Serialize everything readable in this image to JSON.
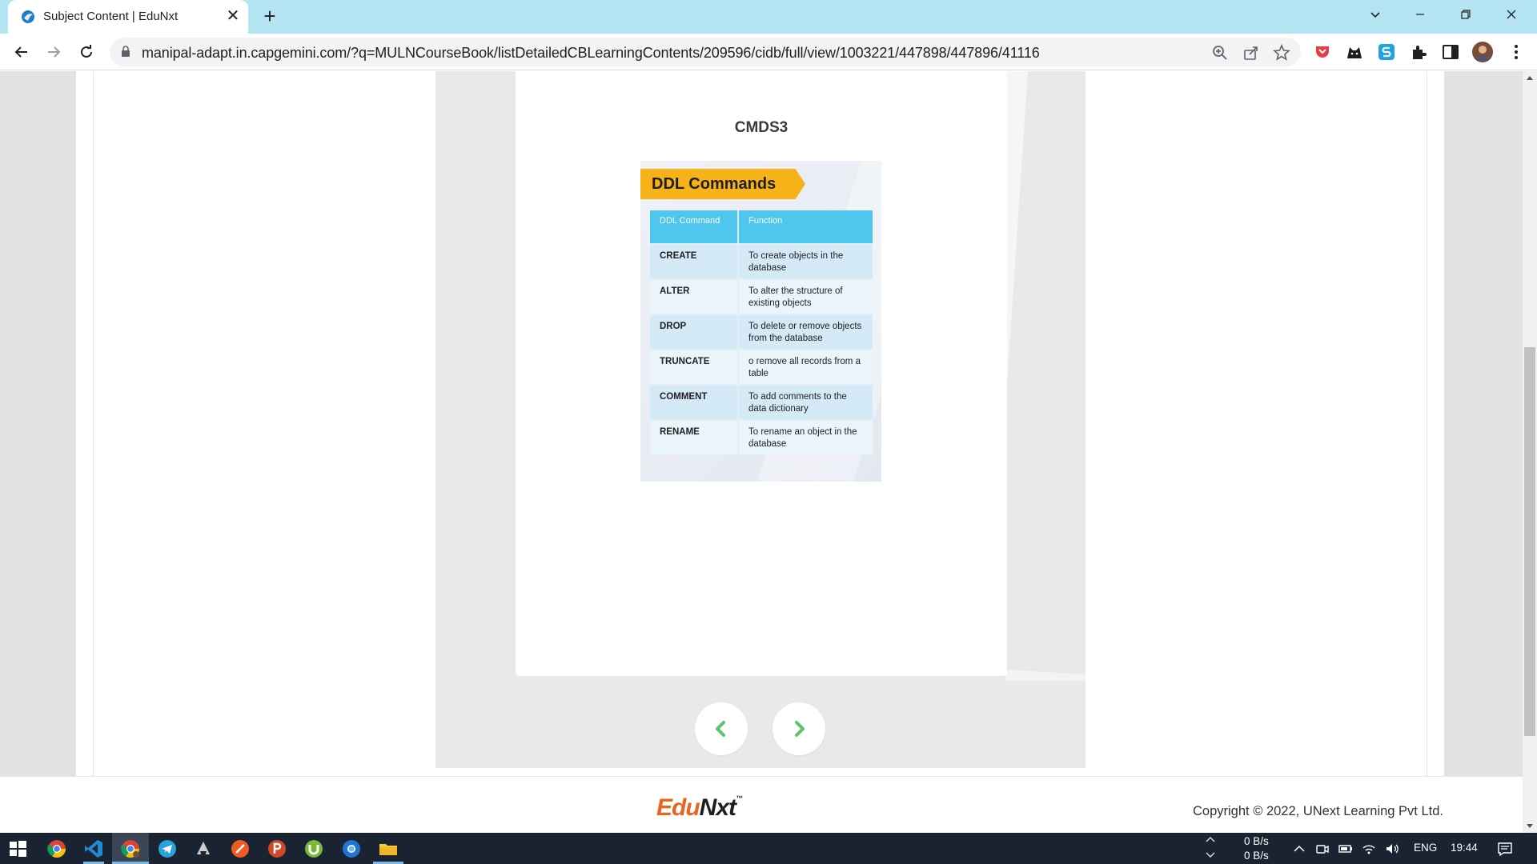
{
  "browser": {
    "tab_title": "Subject Content | EduNxt",
    "tab_close": "✕",
    "new_tab": "+",
    "url": "manipal-adapt.in.capgemini.com/?q=MULNCourseBook/listDetailedCBLearningContents/209596/cidb/full/view/1003221/447898/447896/41116"
  },
  "content": {
    "slide_title": "CMDS3",
    "slide": {
      "banner": "DDL Commands",
      "header": [
        "DDL Command",
        "Function"
      ],
      "rows": [
        {
          "command": "CREATE",
          "function": "To create objects in the database"
        },
        {
          "command": "ALTER",
          "function": "To alter the structure of existing objects"
        },
        {
          "command": "DROP",
          "function": "To delete or remove objects from the database"
        },
        {
          "command": "TRUNCATE",
          "function": "o remove all records from a table"
        },
        {
          "command": "COMMENT",
          "function": "To add comments to the data dictionary"
        },
        {
          "command": "RENAME",
          "function": "To rename an object in the database"
        }
      ]
    },
    "pager": {
      "prev_icon": "chevron-left-icon",
      "next_icon": "chevron-right-icon",
      "accent": "#5cc46a"
    }
  },
  "footer": {
    "logo_edu": "Edu",
    "logo_nxt": "Nxt",
    "logo_tm": "™",
    "copyright": "Copyright © 2022, UNext Learning Pvt Ltd."
  },
  "taskbar": {
    "net_up": "0 B/s",
    "net_down": "0 B/s",
    "language": "ENG",
    "time": "19:44"
  },
  "colors": {
    "tab_strip": "#b4e4f2",
    "banner": "#f7b21a",
    "table_header": "#4fc6ee",
    "logo_orange": "#e8641f",
    "taskbar": "#1a2331"
  }
}
